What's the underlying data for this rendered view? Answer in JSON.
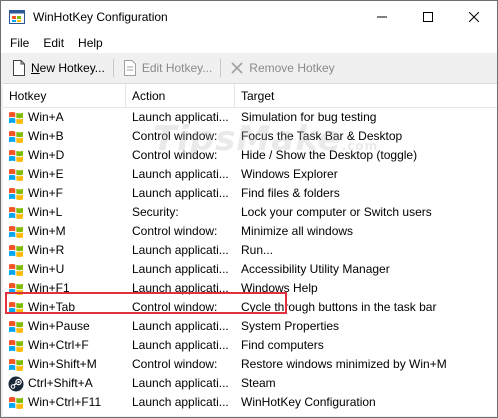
{
  "window": {
    "title": "WinHotKey Configuration",
    "app_icon": "winhotkey-app-icon",
    "minimize_glyph": "—",
    "maximize_glyph": "☐",
    "close_glyph": "✕"
  },
  "menu": {
    "items": [
      {
        "label": "File"
      },
      {
        "label": "Edit"
      },
      {
        "label": "Help"
      }
    ]
  },
  "toolbar": {
    "new_label": "New Hotkey...",
    "edit_label": "Edit Hotkey...",
    "remove_label": "Remove Hotkey"
  },
  "table": {
    "columns": [
      "Hotkey",
      "Action",
      "Target"
    ],
    "rows": [
      {
        "icon": "windows-flag-icon",
        "hotkey": "Win+A",
        "action": "Launch applicati...",
        "target": "Simulation for bug testing"
      },
      {
        "icon": "windows-flag-icon",
        "hotkey": "Win+B",
        "action": "Control window:",
        "target": "Focus the Task Bar & Desktop"
      },
      {
        "icon": "windows-flag-icon",
        "hotkey": "Win+D",
        "action": "Control window:",
        "target": "Hide / Show the Desktop (toggle)"
      },
      {
        "icon": "windows-flag-icon",
        "hotkey": "Win+E",
        "action": "Launch applicati...",
        "target": "Windows Explorer"
      },
      {
        "icon": "windows-flag-icon",
        "hotkey": "Win+F",
        "action": "Launch applicati...",
        "target": "Find files & folders"
      },
      {
        "icon": "windows-flag-icon",
        "hotkey": "Win+L",
        "action": "Security:",
        "target": "Lock your computer or Switch users"
      },
      {
        "icon": "windows-flag-icon",
        "hotkey": "Win+M",
        "action": "Control window:",
        "target": "Minimize all windows"
      },
      {
        "icon": "windows-flag-icon",
        "hotkey": "Win+R",
        "action": "Launch applicati...",
        "target": "Run..."
      },
      {
        "icon": "windows-flag-icon",
        "hotkey": "Win+U",
        "action": "Launch applicati...",
        "target": "Accessibility Utility Manager"
      },
      {
        "icon": "windows-flag-icon",
        "hotkey": "Win+F1",
        "action": "Launch applicati...",
        "target": "Windows Help"
      },
      {
        "icon": "windows-flag-icon",
        "hotkey": "Win+Tab",
        "action": "Control window:",
        "target": "Cycle through buttons in the task bar"
      },
      {
        "icon": "windows-flag-icon",
        "hotkey": "Win+Pause",
        "action": "Launch applicati...",
        "target": "System Properties"
      },
      {
        "icon": "windows-flag-icon",
        "hotkey": "Win+Ctrl+F",
        "action": "Launch applicati...",
        "target": "Find computers"
      },
      {
        "icon": "windows-flag-icon",
        "hotkey": "Win+Shift+M",
        "action": "Control window:",
        "target": "Restore windows minimized by Win+M"
      },
      {
        "icon": "steam-icon",
        "hotkey": "Ctrl+Shift+A",
        "action": "Launch applicati...",
        "target": "Steam"
      },
      {
        "icon": "windows-flag-icon",
        "hotkey": "Win+Ctrl+F11",
        "action": "Launch applicati...",
        "target": "WinHotKey Configuration"
      }
    ]
  },
  "watermark": {
    "text": "TipsMake",
    "suffix": ".com"
  },
  "colors": {
    "highlight_border": "#e0313e",
    "flag_red": "#f35325",
    "flag_green": "#81bc06",
    "flag_blue": "#05a6f0",
    "flag_yellow": "#ffba08"
  }
}
